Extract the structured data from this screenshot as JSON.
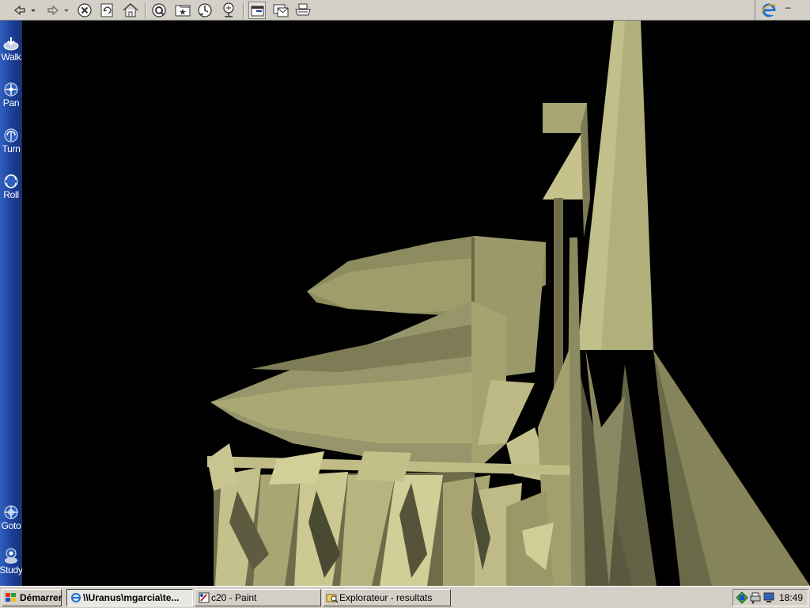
{
  "toolbar": {
    "buttons": [
      {
        "name": "back-icon"
      },
      {
        "name": "forward-icon"
      },
      {
        "name": "stop-icon"
      },
      {
        "name": "refresh-icon"
      },
      {
        "name": "home-icon"
      },
      {
        "name": "search-icon"
      },
      {
        "name": "favorites-icon"
      },
      {
        "name": "history-icon"
      },
      {
        "name": "channels-icon"
      },
      {
        "name": "fullscreen-icon"
      },
      {
        "name": "mail-icon"
      },
      {
        "name": "print-icon"
      }
    ],
    "window_controls": {
      "minimize": "–"
    }
  },
  "sidebar": {
    "items": [
      {
        "label": "Walk"
      },
      {
        "label": "Pan"
      },
      {
        "label": "Turn"
      },
      {
        "label": "Roll"
      },
      {
        "label": "Goto"
      },
      {
        "label": "Study"
      }
    ]
  },
  "viewport": {
    "background": "#000000",
    "model_color": "#b0ad78"
  },
  "taskbar": {
    "start_label": "Démarrer",
    "tasks": [
      {
        "label": "\\\\Uranus\\mgarcia\\te...",
        "active": true
      },
      {
        "label": "c20 - Paint",
        "active": false
      },
      {
        "label": "Explorateur - resultats",
        "active": false
      }
    ],
    "clock": "18:49"
  }
}
